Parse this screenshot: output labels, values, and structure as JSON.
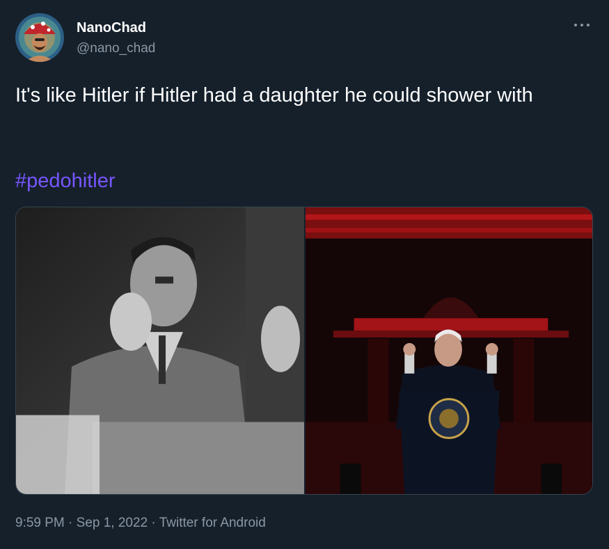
{
  "author": {
    "display_name": "NanoChad",
    "handle": "@nano_chad",
    "avatar_icon": "mushroom-hat-avatar-icon"
  },
  "more_icon": "more-options-icon",
  "tweet": {
    "text": "It's like Hitler if Hitler had a daughter he could shower with",
    "hashtag": "#pedohitler"
  },
  "media": {
    "images": [
      {
        "description_icon": "black-and-white-speaker-photo"
      },
      {
        "description_icon": "red-lit-podium-speaker-photo"
      }
    ]
  },
  "meta": {
    "time": "9:59 PM",
    "separator_1": " · ",
    "date": "Sep 1, 2022",
    "separator_2": " · ",
    "source": "Twitter for Android"
  },
  "colors": {
    "background": "#15202b",
    "secondary_text": "#8b98a5",
    "hashtag": "#7856ff"
  }
}
